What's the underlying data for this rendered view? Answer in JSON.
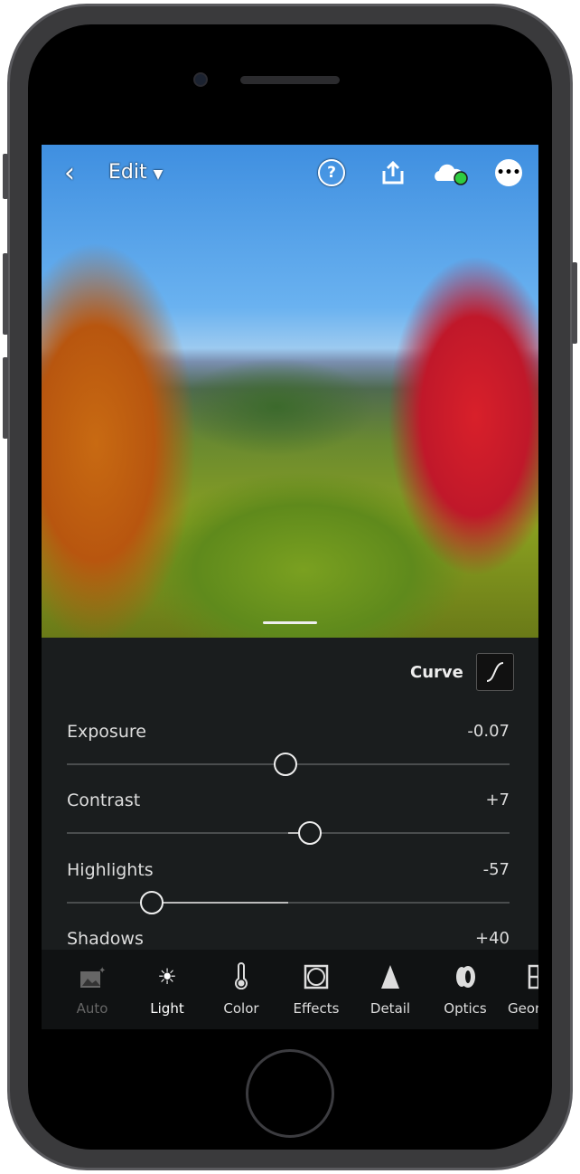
{
  "topbar": {
    "back_icon": "chevron-left-icon",
    "title": "Edit",
    "help_icon": "question-circle-icon",
    "share_icon": "share-icon",
    "cloud_icon": "cloud-synced-icon",
    "more_icon": "ellipsis-circle-icon",
    "cloud_status_color": "#2ecc40"
  },
  "panel": {
    "curve_label": "Curve",
    "curve_icon": "curve-icon",
    "sliders": [
      {
        "label": "Exposure",
        "value": "-0.07",
        "position": 0.495
      },
      {
        "label": "Contrast",
        "value": "+7",
        "position": 0.55
      },
      {
        "label": "Highlights",
        "value": "-57",
        "position": 0.19
      },
      {
        "label": "Shadows",
        "value": "+40"
      }
    ]
  },
  "toolbar": {
    "items": [
      {
        "label": "Auto",
        "icon": "auto-image-icon",
        "enabled": false
      },
      {
        "label": "Light",
        "icon": "sun-icon",
        "active": true
      },
      {
        "label": "Color",
        "icon": "thermometer-icon"
      },
      {
        "label": "Effects",
        "icon": "vignette-icon"
      },
      {
        "label": "Detail",
        "icon": "triangle-icon"
      },
      {
        "label": "Optics",
        "icon": "lens-icon"
      },
      {
        "label": "Geor",
        "icon": "geometry-icon"
      }
    ]
  }
}
